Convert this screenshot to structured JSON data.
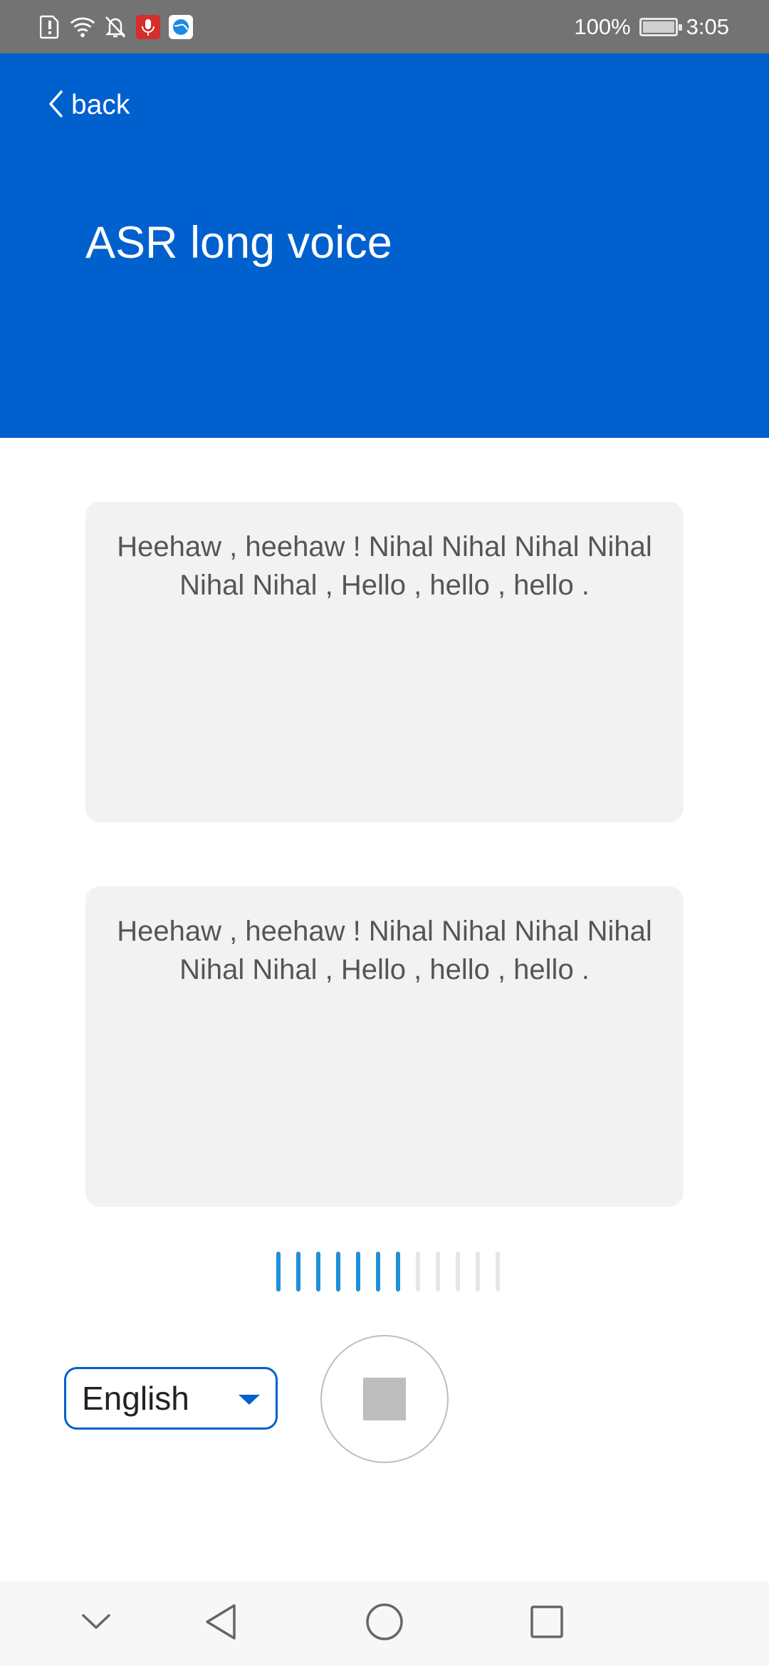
{
  "status_bar": {
    "battery_percent": "100%",
    "time": "3:05",
    "icons": [
      "alert-icon",
      "wifi-icon",
      "bell-off-icon",
      "microphone-icon",
      "app-globe-icon"
    ]
  },
  "header": {
    "back_label": "back",
    "title": "ASR long voice",
    "background_color": "#0060cd"
  },
  "panels": [
    {
      "text": "Heehaw , heehaw ! Nihal Nihal Nihal Nihal Nihal Nihal , Hello , hello , hello ."
    },
    {
      "text": "Heehaw , heehaw ! Nihal Nihal Nihal Nihal Nihal Nihal , Hello , hello , hello ."
    }
  ],
  "voice_meter": {
    "total_bars": 12,
    "active_bars": 7,
    "active_color": "#1e90d8"
  },
  "language_select": {
    "selected": "English"
  },
  "controls": {
    "record_button_state": "stop"
  },
  "nav_bar": {
    "buttons": [
      "chevron-down-icon",
      "back-triangle-icon",
      "home-circle-icon",
      "recents-square-icon"
    ]
  }
}
